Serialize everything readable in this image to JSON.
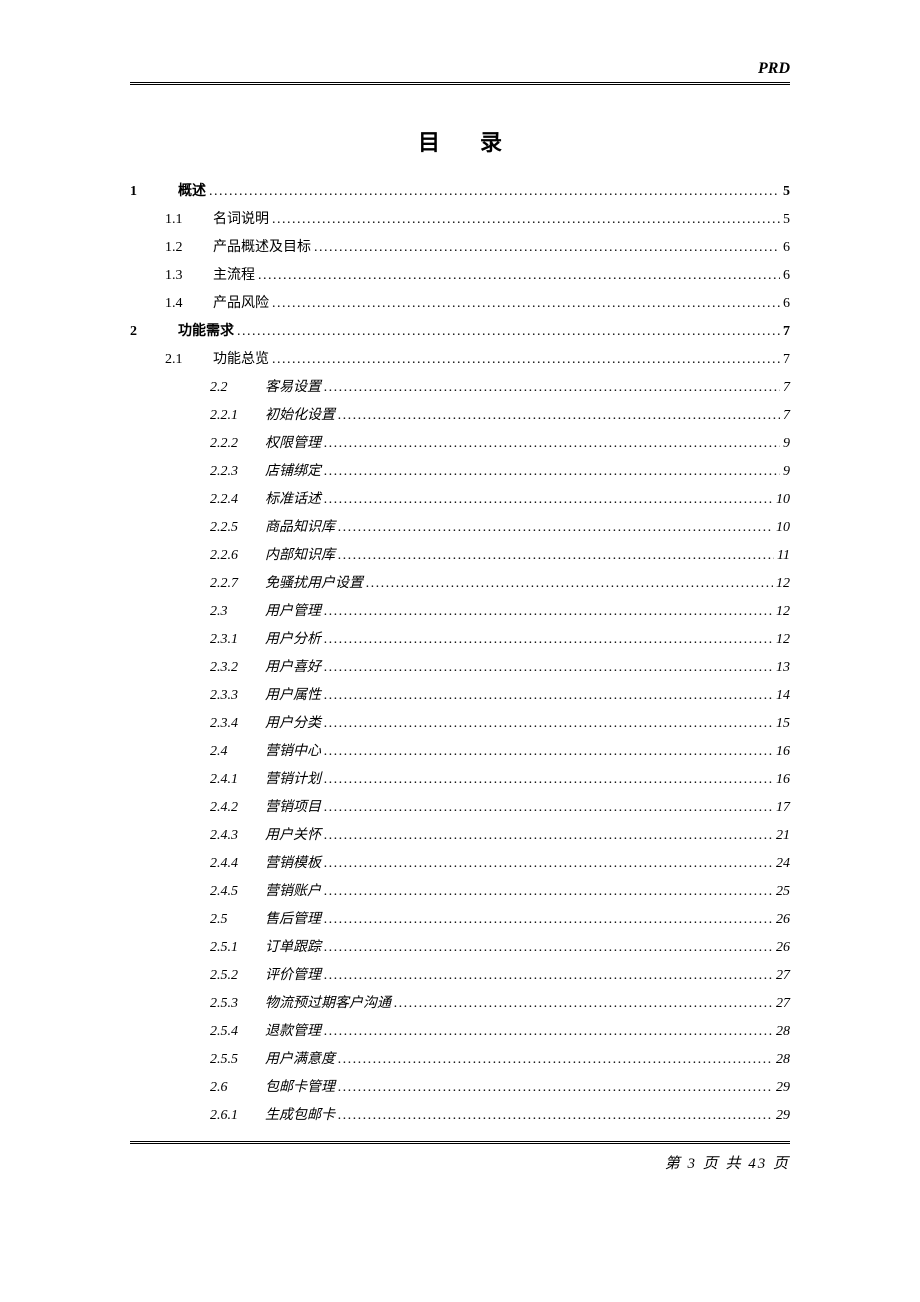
{
  "header": {
    "label": "PRD"
  },
  "title": "目录",
  "toc": [
    {
      "level": 0,
      "num": "1",
      "label": "概述",
      "page": "5"
    },
    {
      "level": 1,
      "num": "1.1",
      "label": "名词说明",
      "page": "5"
    },
    {
      "level": 1,
      "num": "1.2",
      "label": "产品概述及目标",
      "page": "6"
    },
    {
      "level": 1,
      "num": "1.3",
      "label": "主流程",
      "page": "6"
    },
    {
      "level": 1,
      "num": "1.4",
      "label": "产品风险",
      "page": "6"
    },
    {
      "level": 0,
      "num": "2",
      "label": "功能需求",
      "page": "7"
    },
    {
      "level": 1,
      "num": "2.1",
      "label": "功能总览",
      "page": "7"
    },
    {
      "level": 2,
      "num": "2.2",
      "label": "客易设置",
      "page": "7"
    },
    {
      "level": 2,
      "num": "2.2.1",
      "label": "初始化设置",
      "page": "7"
    },
    {
      "level": 2,
      "num": "2.2.2",
      "label": "权限管理",
      "page": "9"
    },
    {
      "level": 2,
      "num": "2.2.3",
      "label": "店铺绑定",
      "page": "9"
    },
    {
      "level": 2,
      "num": "2.2.4",
      "label": "标准话述",
      "page": "10"
    },
    {
      "level": 2,
      "num": "2.2.5",
      "label": "商品知识库",
      "page": "10"
    },
    {
      "level": 2,
      "num": "2.2.6",
      "label": "内部知识库",
      "page": "11"
    },
    {
      "level": 2,
      "num": "2.2.7",
      "label": "免骚扰用户设置",
      "page": "12"
    },
    {
      "level": 2,
      "num": "2.3",
      "label": "用户管理",
      "page": "12"
    },
    {
      "level": 2,
      "num": "2.3.1",
      "label": "用户分析",
      "page": "12"
    },
    {
      "level": 2,
      "num": "2.3.2",
      "label": "用户喜好",
      "page": "13"
    },
    {
      "level": 2,
      "num": "2.3.3",
      "label": "用户属性",
      "page": "14"
    },
    {
      "level": 2,
      "num": "2.3.4",
      "label": "用户分类",
      "page": "15"
    },
    {
      "level": 2,
      "num": "2.4",
      "label": "营销中心",
      "page": "16"
    },
    {
      "level": 2,
      "num": "2.4.1",
      "label": "营销计划",
      "page": "16"
    },
    {
      "level": 2,
      "num": "2.4.2",
      "label": "营销项目",
      "page": "17"
    },
    {
      "level": 2,
      "num": "2.4.3",
      "label": "用户关怀",
      "page": "21"
    },
    {
      "level": 2,
      "num": "2.4.4",
      "label": "营销模板",
      "page": "24"
    },
    {
      "level": 2,
      "num": "2.4.5",
      "label": "营销账户",
      "page": "25"
    },
    {
      "level": 2,
      "num": "2.5",
      "label": "售后管理",
      "page": "26"
    },
    {
      "level": 2,
      "num": "2.5.1",
      "label": "订单跟踪",
      "page": "26"
    },
    {
      "level": 2,
      "num": "2.5.2",
      "label": "评价管理",
      "page": "27"
    },
    {
      "level": 2,
      "num": "2.5.3",
      "label": "物流预过期客户沟通",
      "page": "27"
    },
    {
      "level": 2,
      "num": "2.5.4",
      "label": "退款管理",
      "page": "28"
    },
    {
      "level": 2,
      "num": "2.5.5",
      "label": "用户满意度",
      "page": "28"
    },
    {
      "level": 2,
      "num": "2.6",
      "label": "包邮卡管理",
      "page": "29"
    },
    {
      "level": 2,
      "num": "2.6.1",
      "label": "生成包邮卡",
      "page": "29"
    }
  ],
  "footer": {
    "text": "第 3 页 共 43 页"
  }
}
